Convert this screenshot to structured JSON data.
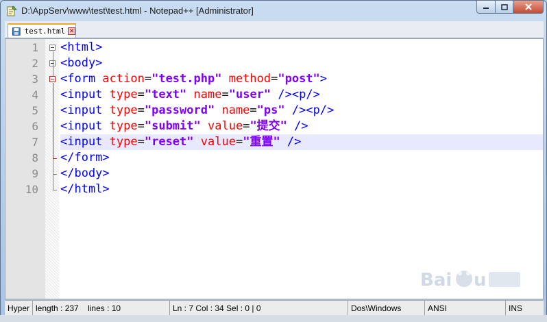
{
  "window": {
    "title": "D:\\AppServ\\www\\test\\test.html - Notepad++ [Administrator]"
  },
  "tabs": [
    {
      "label": "test.html",
      "active": true
    }
  ],
  "editor": {
    "line_numbers": [
      "1",
      "2",
      "3",
      "4",
      "5",
      "6",
      "7",
      "8",
      "9",
      "10"
    ],
    "current_line": 7,
    "lines": [
      [
        {
          "c": "t",
          "s": "<html>"
        }
      ],
      [
        {
          "c": "t",
          "s": "<body>"
        }
      ],
      [
        {
          "c": "t",
          "s": "<form "
        },
        {
          "c": "a",
          "s": "action"
        },
        {
          "c": "eq",
          "s": "="
        },
        {
          "c": "v",
          "s": "\"test.php\""
        },
        {
          "c": "t",
          "s": " "
        },
        {
          "c": "a",
          "s": "method"
        },
        {
          "c": "eq",
          "s": "="
        },
        {
          "c": "v",
          "s": "\"post\""
        },
        {
          "c": "t",
          "s": ">"
        }
      ],
      [
        {
          "c": "t",
          "s": "<input "
        },
        {
          "c": "a",
          "s": "type"
        },
        {
          "c": "eq",
          "s": "="
        },
        {
          "c": "v",
          "s": "\"text\""
        },
        {
          "c": "t",
          "s": " "
        },
        {
          "c": "a",
          "s": "name"
        },
        {
          "c": "eq",
          "s": "="
        },
        {
          "c": "v",
          "s": "\"user\""
        },
        {
          "c": "t",
          "s": " /><p/>"
        }
      ],
      [
        {
          "c": "t",
          "s": "<input "
        },
        {
          "c": "a",
          "s": "type"
        },
        {
          "c": "eq",
          "s": "="
        },
        {
          "c": "v",
          "s": "\"password\""
        },
        {
          "c": "t",
          "s": " "
        },
        {
          "c": "a",
          "s": "name"
        },
        {
          "c": "eq",
          "s": "="
        },
        {
          "c": "v",
          "s": "\"ps\""
        },
        {
          "c": "t",
          "s": " /><p/>"
        }
      ],
      [
        {
          "c": "t",
          "s": "<input "
        },
        {
          "c": "a",
          "s": "type"
        },
        {
          "c": "eq",
          "s": "="
        },
        {
          "c": "v",
          "s": "\"submit\""
        },
        {
          "c": "t",
          "s": " "
        },
        {
          "c": "a",
          "s": "value"
        },
        {
          "c": "eq",
          "s": "="
        },
        {
          "c": "v",
          "s": "\"提交\""
        },
        {
          "c": "t",
          "s": " />"
        }
      ],
      [
        {
          "c": "t",
          "s": "<input "
        },
        {
          "c": "a",
          "s": "type"
        },
        {
          "c": "eq",
          "s": "="
        },
        {
          "c": "v",
          "s": "\"reset\""
        },
        {
          "c": "t",
          "s": " "
        },
        {
          "c": "a",
          "s": "value"
        },
        {
          "c": "eq",
          "s": "="
        },
        {
          "c": "v",
          "s": "\"重置\""
        },
        {
          "c": "t",
          "s": " />"
        }
      ],
      [
        {
          "c": "t",
          "s": "</form>"
        }
      ],
      [
        {
          "c": "t",
          "s": "</body>"
        }
      ],
      [
        {
          "c": "t",
          "s": "</html>"
        }
      ]
    ]
  },
  "statusbar": {
    "doc_type": "Hyper",
    "length": "length : 237",
    "lines": "lines : 10",
    "position": "Ln : 7    Col : 34    Sel : 0 | 0",
    "eol": "Dos\\Windows",
    "encoding": "ANSI",
    "mode": "INS"
  },
  "colors": {
    "tag": "#0000ff",
    "attribute": "#ff0000",
    "value": "#8000ff",
    "current_line": "#e8e8ff",
    "fold_marker": "#d02020"
  }
}
